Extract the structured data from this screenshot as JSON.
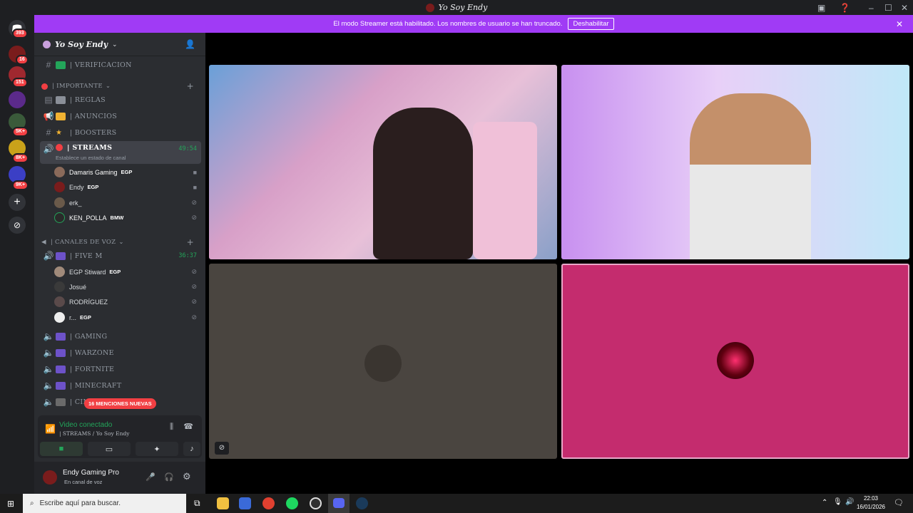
{
  "window": {
    "title": "Yo Soy Endy"
  },
  "banner": {
    "text": "El modo Streamer está habilitado. Los nombres de usuario se han truncado.",
    "button": "Deshabilitar"
  },
  "rail": {
    "badges": [
      "393",
      "16",
      "151",
      "5K+",
      "8K+",
      "9K+"
    ]
  },
  "server": {
    "name": "Yo Soy Endy"
  },
  "channels": {
    "verificacion": "| VERIFICACION",
    "cat_importante": "| IMPORTANTE",
    "reglas": "| REGLAS",
    "anuncios": "| ANUNCIOS",
    "boosters": "| BOOSTERS",
    "streams": "| STREAMS",
    "streams_timer": "49:54",
    "streams_status": "Establece un estado de canal",
    "cat_voz": "| CANALES DE VOZ",
    "fivem": "| FIVE M",
    "fivem_timer": "36:37",
    "gaming": "| GAMING",
    "warzone": "| WARZONE",
    "fortnite": "| FORTNITE",
    "minecraft": "| MINECRAFT",
    "cin": "| CIN"
  },
  "streams_users": [
    {
      "name": "Damaris Gaming",
      "tag": "EGP"
    },
    {
      "name": "Endy",
      "tag": "EGP"
    },
    {
      "name": "erk_",
      "tag": ""
    },
    {
      "name": "KEN_POLLA",
      "tag": "BMW"
    }
  ],
  "fivem_users": [
    {
      "name": "EGP Stiward",
      "tag": "EGP"
    },
    {
      "name": "Josué",
      "tag": ""
    },
    {
      "name": "RODRÍGUEZ",
      "tag": ""
    },
    {
      "name": "r...",
      "tag": "EGP"
    }
  ],
  "mentions": "16 MENCIONES NUEVAS",
  "voice": {
    "status": "Video conectado",
    "channel": "| STREAMS / Yo Soy Endy"
  },
  "user": {
    "name": "Endy Gaming Pro",
    "status": "En canal de voz"
  },
  "taskbar": {
    "search_placeholder": "Escribe aquí para buscar.",
    "time": "22:03",
    "date": "16/01/2026"
  },
  "colors": {
    "accent": "#a03bf5",
    "danger": "#f23f43",
    "online": "#23a55a",
    "tile_pink": "#c42c6e",
    "tile_gray": "#4a4540"
  }
}
